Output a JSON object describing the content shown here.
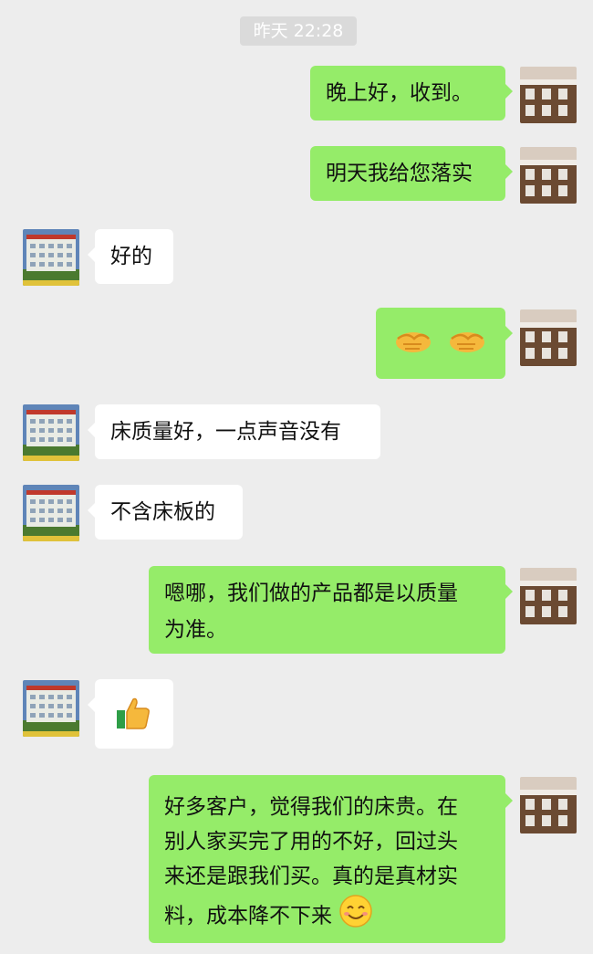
{
  "timestamp": "昨天 22:28",
  "messages": [
    {
      "side": "out",
      "text": "晚上好，收到。"
    },
    {
      "side": "out",
      "text": "明天我给您落实"
    },
    {
      "side": "in",
      "text": "好的"
    },
    {
      "side": "out",
      "emoji": [
        "handshake-emoji",
        "handshake-emoji"
      ]
    },
    {
      "side": "in",
      "text": "床质量好，一点声音没有"
    },
    {
      "side": "in",
      "text": "不含床板的"
    },
    {
      "side": "out",
      "text_lines": [
        "嗯哪，我们做的产品都是以质量",
        "为准。"
      ]
    },
    {
      "side": "in",
      "emoji": [
        "thumbs-up-emoji"
      ]
    },
    {
      "side": "out",
      "text_lines": [
        "好多客户，觉得我们的床贵。在",
        "别人家买完了用的不好，回过头",
        "来还是跟我们买。真的是真材实",
        "料，成本降不下来"
      ],
      "trailing_emoji": "smile-emoji"
    }
  ],
  "colors": {
    "background": "#ededed",
    "outgoing": "#95ec69",
    "incoming": "#ffffff",
    "timestamp_bg": "#dadada"
  }
}
